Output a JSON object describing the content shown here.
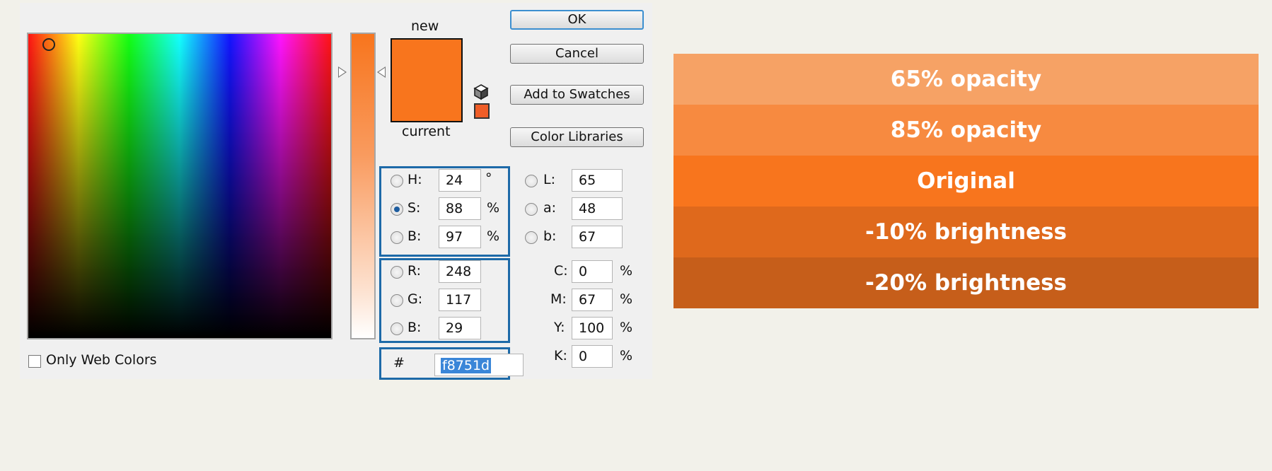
{
  "dialog": {
    "new_label": "new",
    "current_label": "current",
    "new_color": "#f8751d",
    "current_color": "#f8751d",
    "mini_swatch_color": "#ef5d27",
    "buttons": {
      "ok": "OK",
      "cancel": "Cancel",
      "add_to_swatches": "Add to Swatches",
      "color_libraries": "Color Libraries"
    },
    "hsb": [
      {
        "label": "H:",
        "value": "24",
        "unit": "°",
        "selected": false
      },
      {
        "label": "S:",
        "value": "88",
        "unit": "%",
        "selected": true
      },
      {
        "label": "B:",
        "value": "97",
        "unit": "%",
        "selected": false
      }
    ],
    "rgb": [
      {
        "label": "R:",
        "value": "248"
      },
      {
        "label": "G:",
        "value": "117"
      },
      {
        "label": "B:",
        "value": "29"
      }
    ],
    "lab": [
      {
        "label": "L:",
        "value": "65"
      },
      {
        "label": "a:",
        "value": "48"
      },
      {
        "label": "b:",
        "value": "67"
      }
    ],
    "cmyk": [
      {
        "label": "C:",
        "value": "0",
        "unit": "%"
      },
      {
        "label": "M:",
        "value": "67",
        "unit": "%"
      },
      {
        "label": "Y:",
        "value": "100",
        "unit": "%"
      },
      {
        "label": "K:",
        "value": "0",
        "unit": "%"
      }
    ],
    "hex_prefix": "#",
    "hex_value": "f8751d",
    "only_web_colors": "Only Web Colors",
    "only_web_colors_checked": false
  },
  "bars": [
    {
      "label": "65% opacity",
      "color": "#f6a265"
    },
    {
      "label": "85% opacity",
      "color": "#f78a40"
    },
    {
      "label": "Original",
      "color": "#f8751d"
    },
    {
      "label": "-10% brightness",
      "color": "#df691c"
    },
    {
      "label": "-20% brightness",
      "color": "#c65e1a"
    }
  ]
}
